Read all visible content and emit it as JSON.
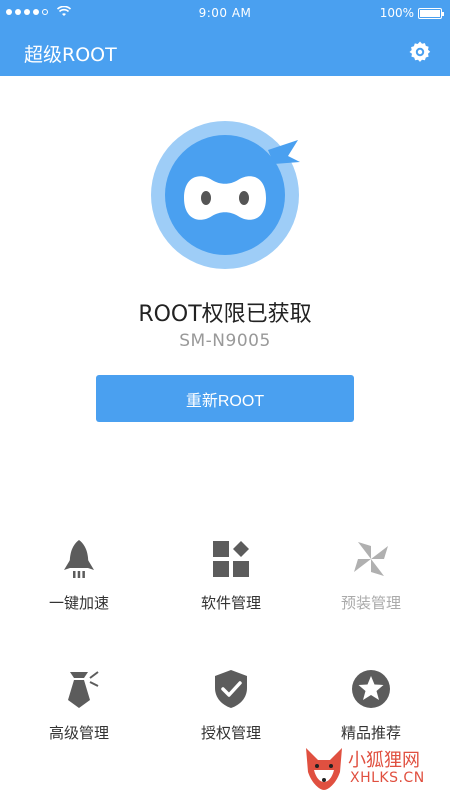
{
  "status_bar": {
    "time": "9:00 AM",
    "battery": "100%",
    "battery_level": 1.0,
    "signal_dots": 5,
    "signal_filled": 4
  },
  "app_bar": {
    "title": "超级ROOT",
    "settings_icon": "gear-icon"
  },
  "main": {
    "status_title": "ROOT权限已获取",
    "device_model": "SM-N9005",
    "reroot_button": "重新ROOT",
    "mascot_icon": "ninja-mascot"
  },
  "features": [
    {
      "label": "一键加速",
      "icon": "rocket-icon",
      "enabled": true
    },
    {
      "label": "软件管理",
      "icon": "apps-grid-icon",
      "enabled": true
    },
    {
      "label": "预装管理",
      "icon": "pinwheel-icon",
      "enabled": false
    },
    {
      "label": "高级管理",
      "icon": "tie-icon",
      "enabled": true
    },
    {
      "label": "授权管理",
      "icon": "shield-check-icon",
      "enabled": true
    },
    {
      "label": "精品推荐",
      "icon": "star-circle-icon",
      "enabled": true
    }
  ],
  "watermark": {
    "title": "小狐狸网",
    "subtitle": "XHLKS.CN"
  },
  "colors": {
    "primary": "#4aa0f0",
    "mascot_light": "#9ecdf7",
    "icon_gray": "#5c5c5c",
    "icon_disabled": "#b0b0b0",
    "watermark": "#e05040"
  }
}
